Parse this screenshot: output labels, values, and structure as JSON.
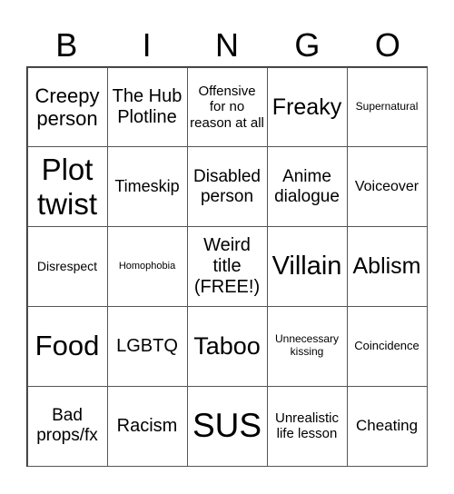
{
  "header": [
    "B",
    "I",
    "N",
    "G",
    "O"
  ],
  "cells": [
    "Creepy person",
    "The Hub Plotline",
    "Offensive for no reason at all",
    "Freaky",
    "Supernatural",
    "Plot twist",
    "Timeskip",
    "Disabled person",
    "Anime dialogue",
    "Voiceover",
    "Disrespect",
    "Homophobia",
    "Weird title (FREE!)",
    "Villain",
    "Ablism",
    "Food",
    "LGBTQ",
    "Taboo",
    "Unnecessary kissing",
    "Coincidence",
    "Bad props/fx",
    "Racism",
    "SUS",
    "Unrealistic life lesson",
    "Cheating"
  ]
}
